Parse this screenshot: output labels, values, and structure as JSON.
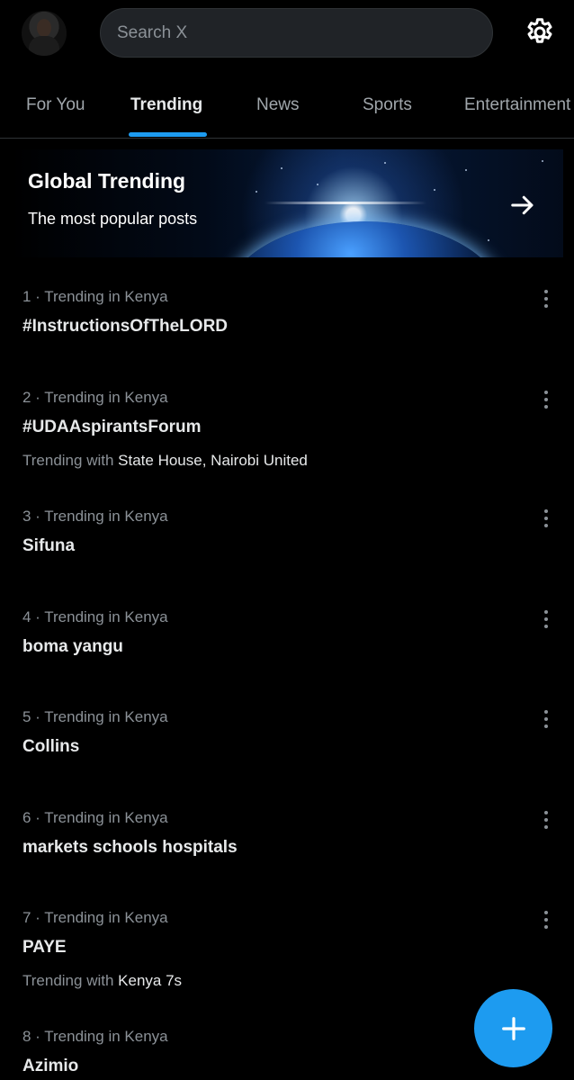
{
  "header": {
    "search_placeholder": "Search X"
  },
  "tabs": [
    {
      "label": "For You",
      "active": false
    },
    {
      "label": "Trending",
      "active": true
    },
    {
      "label": "News",
      "active": false
    },
    {
      "label": "Sports",
      "active": false
    },
    {
      "label": "Entertainment",
      "active": false
    }
  ],
  "banner": {
    "title": "Global Trending",
    "subtitle": "The most popular posts"
  },
  "trends": [
    {
      "meta": "1 · Trending in Kenya",
      "name": "#InstructionsOfTheLORD",
      "with_prefix": "",
      "with_value": ""
    },
    {
      "meta": "2 · Trending in Kenya",
      "name": "#UDAAspirantsForum",
      "with_prefix": "Trending with",
      "with_value": "State House, Nairobi United"
    },
    {
      "meta": "3 · Trending in Kenya",
      "name": "Sifuna",
      "with_prefix": "",
      "with_value": ""
    },
    {
      "meta": "4 · Trending in Kenya",
      "name": "boma yangu",
      "with_prefix": "",
      "with_value": ""
    },
    {
      "meta": "5 · Trending in Kenya",
      "name": "Collins",
      "with_prefix": "",
      "with_value": ""
    },
    {
      "meta": "6 · Trending in Kenya",
      "name": "markets schools hospitals",
      "with_prefix": "",
      "with_value": ""
    },
    {
      "meta": "7 · Trending in Kenya",
      "name": "PAYE",
      "with_prefix": "Trending with",
      "with_value": "Kenya 7s"
    },
    {
      "meta": "8 · Trending in Kenya",
      "name": "Azimio",
      "with_prefix": "",
      "with_value": ""
    }
  ],
  "icons": {
    "settings": "gear-icon",
    "banner_arrow": "arrow-right-icon",
    "more": "more-vertical-icon",
    "compose": "plus-icon"
  },
  "colors": {
    "accent": "#1d9bf0",
    "background": "#000000",
    "muted_text": "#8b9197"
  }
}
